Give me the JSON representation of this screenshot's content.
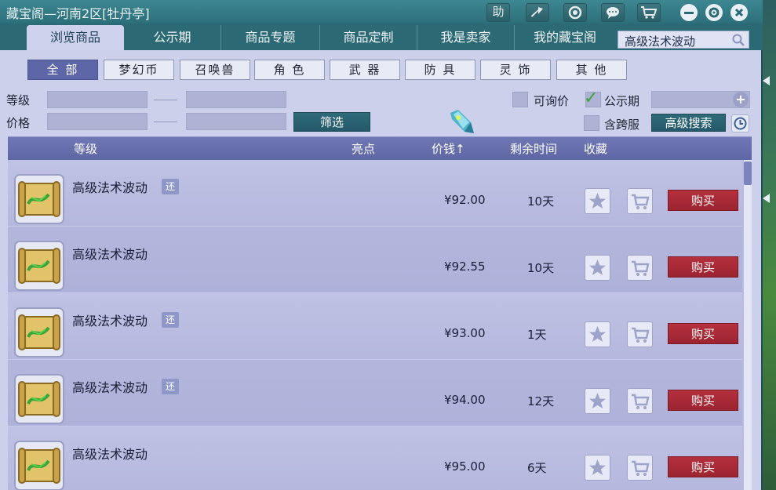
{
  "window": {
    "title": "藏宝阁—河南2区[牡丹亭]",
    "title_buttons": [
      "助"
    ]
  },
  "tabs": [
    {
      "label": "浏览商品",
      "active": true
    },
    {
      "label": "公示期"
    },
    {
      "label": "商品专题"
    },
    {
      "label": "商品定制"
    },
    {
      "label": "我是卖家"
    },
    {
      "label": "我的藏宝阁"
    }
  ],
  "search": {
    "value": "高级法术波动"
  },
  "categories": [
    {
      "label": "全 部",
      "active": true
    },
    {
      "label": "梦幻币"
    },
    {
      "label": "召唤兽"
    },
    {
      "label": "角 色"
    },
    {
      "label": "武 器"
    },
    {
      "label": "防 具"
    },
    {
      "label": "灵 饰"
    },
    {
      "label": "其 他"
    }
  ],
  "filters": {
    "level_label": "等级",
    "price_label": "价格",
    "filter_button": "筛选",
    "inquiry_label": "可询价",
    "public_label": "公示期",
    "public_checked": true,
    "cross_server_label": "含跨服",
    "advanced_button": "高级搜索"
  },
  "table": {
    "headers": {
      "level": "等级",
      "highlight": "亮点",
      "price": "价钱↑",
      "remaining": "剩余时间",
      "favorite": "收藏"
    },
    "rows": [
      {
        "name": "高级法术波动",
        "badge": "还",
        "price": "¥92.00",
        "remaining": "10天",
        "buy": "购买"
      },
      {
        "name": "高级法术波动",
        "badge": "",
        "price": "¥92.55",
        "remaining": "10天",
        "buy": "购买"
      },
      {
        "name": "高级法术波动",
        "badge": "还",
        "price": "¥93.00",
        "remaining": "1天",
        "buy": "购买"
      },
      {
        "name": "高级法术波动",
        "badge": "还",
        "price": "¥94.00",
        "remaining": "12天",
        "buy": "购买"
      },
      {
        "name": "高级法术波动",
        "badge": "",
        "price": "¥95.00",
        "remaining": "6天",
        "buy": "购买"
      }
    ]
  },
  "colors": {
    "titlebar": "#2c6f7a",
    "panel": "#ccd0ea",
    "accent": "#5d66a6",
    "buy_button": "#b5303d"
  }
}
